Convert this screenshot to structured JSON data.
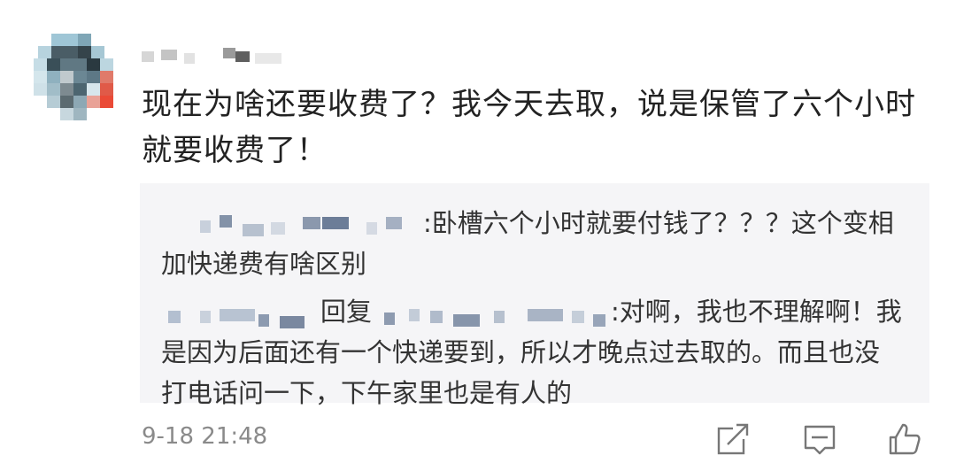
{
  "comment": {
    "text": "现在为啥还要收费了？我今天去取，说是保管了六个小时就要收费了！",
    "time": "9-18 21:48"
  },
  "replies": [
    {
      "text_after_name": ":卧槽六个小时就要付钱了？？？这个变相加快递费有啥区别"
    },
    {
      "reply_prefix": "回复",
      "text_after_name": ":对啊，我也不理解啊！我是因为后面还有一个快递要到，所以才晚点过去取的。而且也没打电话问一下，下午家里也是有人的"
    }
  ],
  "icons": {
    "share": "share-icon",
    "reply": "comment-icon",
    "like": "thumbs-up-icon"
  },
  "colors": {
    "text": "#222222",
    "quote_bg": "#f5f5f7",
    "meta": "#8a8a8a"
  }
}
